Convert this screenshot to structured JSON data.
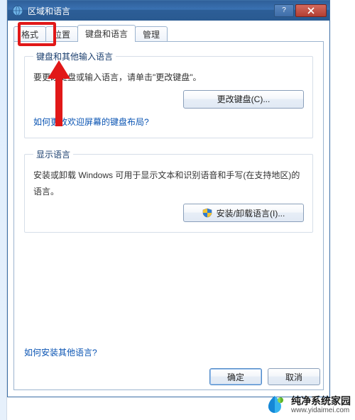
{
  "window": {
    "title": "区域和语言",
    "close_icon": "close-icon",
    "help_icon": "help-icon"
  },
  "tabs": [
    {
      "label": "格式",
      "active": false
    },
    {
      "label": "位置",
      "active": false
    },
    {
      "label": "键盘和语言",
      "active": true
    },
    {
      "label": "管理",
      "active": false
    }
  ],
  "group_keyboard": {
    "legend": "键盘和其他输入语言",
    "desc": "要更改键盘或输入语言，请单击\"更改键盘\"。",
    "change_btn": "更改键盘(C)...",
    "link": "如何更改欢迎屏幕的键盘布局?"
  },
  "group_display": {
    "legend": "显示语言",
    "desc": "安装或卸载 Windows 可用于显示文本和识别语音和手写(在支持地区)的语言。",
    "install_btn": "安装/卸载语言(I)..."
  },
  "bottom_link": "如何安装其他语言?",
  "buttons": {
    "ok": "确定",
    "cancel": "取消"
  },
  "watermark": {
    "name": "纯净系统家园",
    "url": "www.yidaimei.com"
  }
}
